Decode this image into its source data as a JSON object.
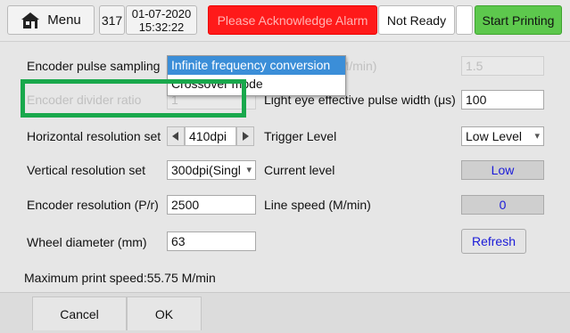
{
  "topbar": {
    "menu_label": "Menu",
    "counter": "317",
    "date": "01-07-2020",
    "time": "15:32:22",
    "alarm": "Please Acknowledge Alarm",
    "status": "Not Ready",
    "start_label": "Start Printing"
  },
  "form": {
    "encoder_pulse_sampling": {
      "label": "Encoder pulse sampling"
    },
    "encoder_divider_ratio": {
      "label": "Encoder divider ratio",
      "value": "1"
    },
    "horizontal_resolution": {
      "label": "Horizontal resolution set",
      "value": "410dpi"
    },
    "vertical_resolution": {
      "label": "Vertical resolution set",
      "value": "300dpi(Singl"
    },
    "encoder_resolution": {
      "label": "Encoder resolution (P/r)",
      "value": "2500"
    },
    "wheel_diameter": {
      "label": "Wheel diameter (mm)",
      "value": "63"
    },
    "obscured_speed": {
      "label_fragment": "peed (M/min)",
      "value": "1.5"
    },
    "light_eye_pulse_width": {
      "label": "Light eye effective pulse width (μs)",
      "value": "100"
    },
    "trigger_level": {
      "label": "Trigger Level",
      "value": "Low Level"
    },
    "current_level": {
      "label": "Current level",
      "value": "Low"
    },
    "line_speed": {
      "label": "Line speed (M/min)",
      "value": "0"
    },
    "refresh_label": "Refresh",
    "max_speed": "Maximum print speed:55.75 M/min"
  },
  "dropdown": {
    "options": [
      "Infinite frequency conversion",
      "Crossover mode"
    ]
  },
  "bottom": {
    "cancel": "Cancel",
    "ok": "OK"
  },
  "colors": {
    "alarm": "#ff1a1a",
    "start": "#5dc84d",
    "highlight": "#19a84c",
    "selected": "#3b8ed8"
  },
  "icons": [
    "home-icon",
    "chevron-down-icon",
    "arrow-left-icon",
    "arrow-right-icon"
  ]
}
